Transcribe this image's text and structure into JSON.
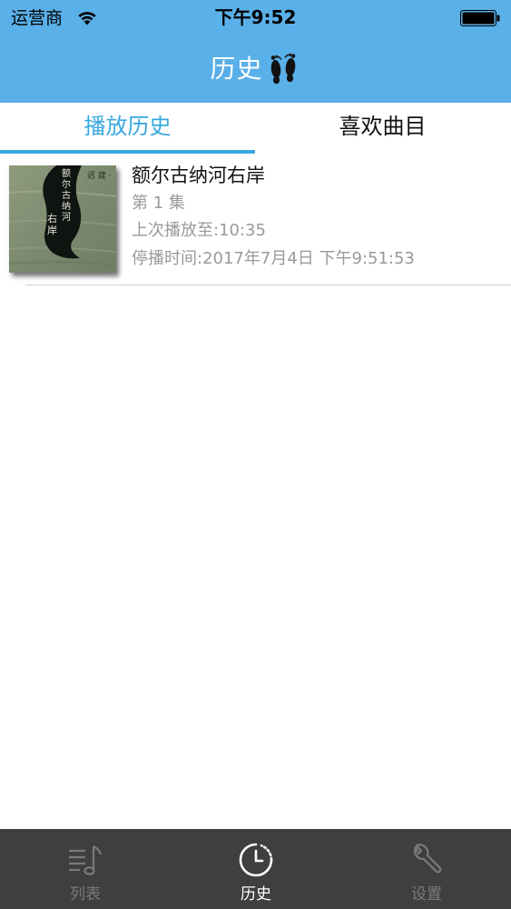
{
  "status_bar": {
    "carrier": "运营商",
    "time": "下午9:52"
  },
  "nav": {
    "title": "历史"
  },
  "tabs": [
    {
      "label": "播放历史",
      "selected": true
    },
    {
      "label": "喜欢曲目",
      "selected": false
    }
  ],
  "history": [
    {
      "title": "额尔古纳河右岸",
      "episode": "第 1 集",
      "progress": "上次播放至:10:35",
      "stopped_at": "停播时间:2017年7月4日 下午9:51:53",
      "cover_text": "额尔古纳河右岸"
    }
  ],
  "tab_bar": [
    {
      "label": "列表",
      "icon": "music-list-icon",
      "active": false
    },
    {
      "label": "历史",
      "icon": "clock-icon",
      "active": true
    },
    {
      "label": "设置",
      "icon": "wrench-icon",
      "active": false
    }
  ],
  "colors": {
    "nav_background": "#5ab0e8",
    "accent": "#38a8e0",
    "tab_bar_background": "#3f3f40",
    "secondary_text": "#9a9a9a"
  }
}
